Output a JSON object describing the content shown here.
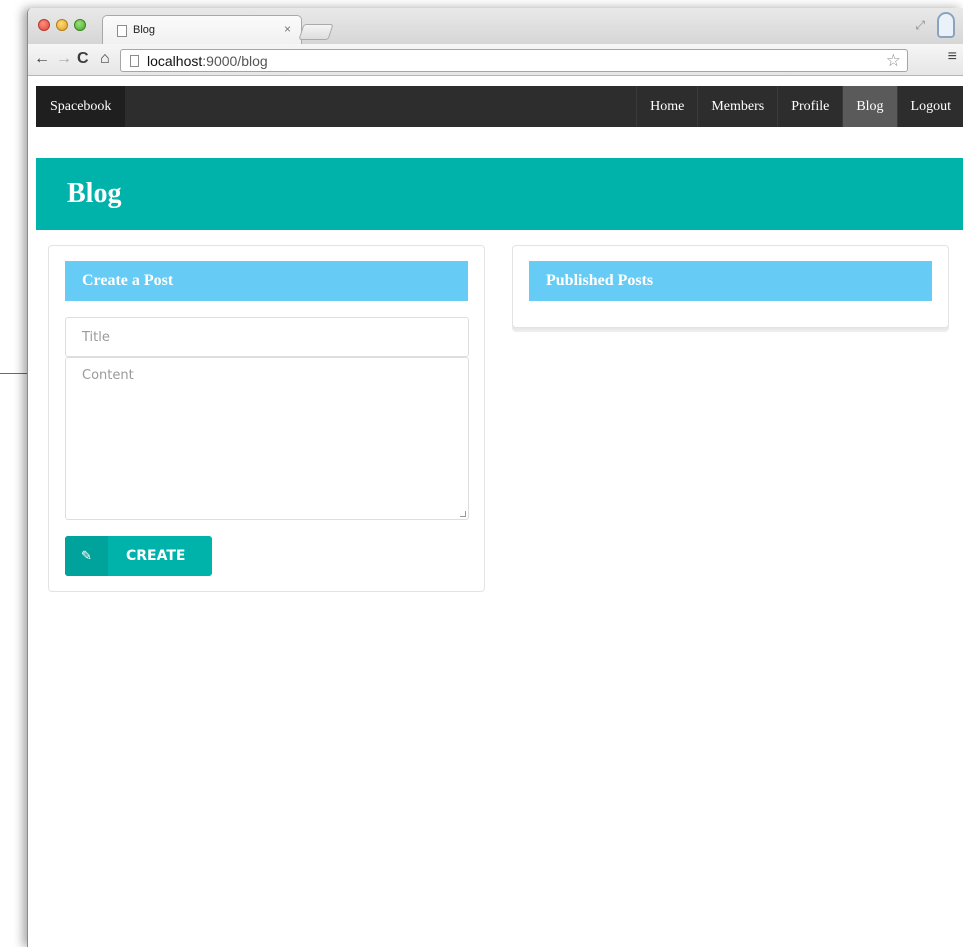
{
  "browser": {
    "tab_title": "Blog",
    "tab_close": "×",
    "url_host": "localhost",
    "url_rest": ":9000/blog"
  },
  "navbar": {
    "brand": "Spacebook",
    "items": [
      {
        "label": "Home",
        "active": false
      },
      {
        "label": "Members",
        "active": false
      },
      {
        "label": "Profile",
        "active": false
      },
      {
        "label": "Blog",
        "active": true
      },
      {
        "label": "Logout",
        "active": false
      }
    ]
  },
  "banner": {
    "title": "Blog"
  },
  "create_card": {
    "title": "Create a Post",
    "title_placeholder": "Title",
    "content_placeholder": "Content",
    "button_label": "CREATE"
  },
  "published_card": {
    "title": "Published Posts"
  },
  "colors": {
    "navbar": "#2d2d2d",
    "banner": "#00b3aa",
    "card_header": "#66ccf5",
    "button": "#00b3aa"
  }
}
